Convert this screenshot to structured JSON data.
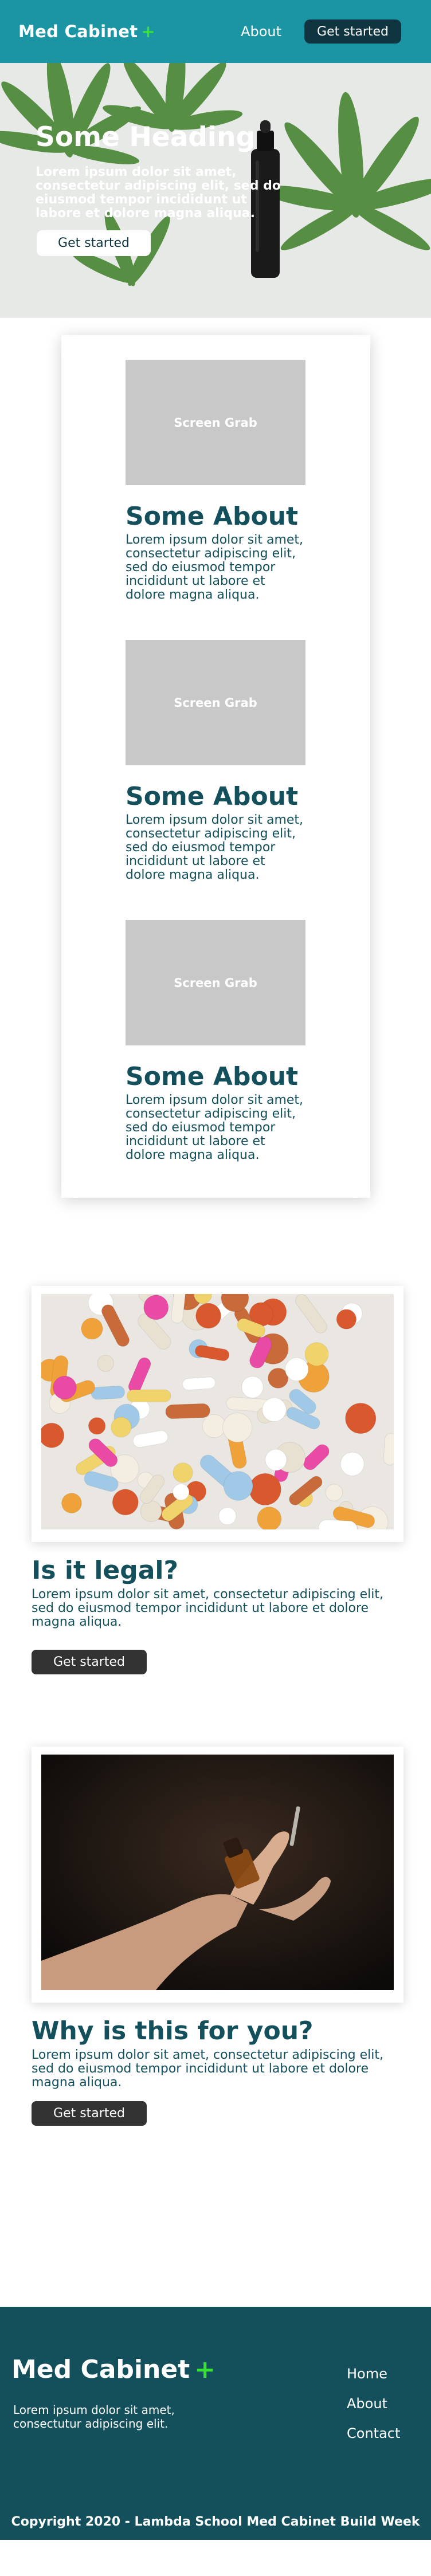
{
  "header": {
    "brand": "Med Cabinet",
    "brand_plus": "+",
    "nav_about": "About",
    "cta": "Get started"
  },
  "hero": {
    "heading": "Some Heading",
    "body": "Lorem ipsum dolor sit amet, consectetur adipiscing elit, sed do eiusmod tempor incididunt ut labore et dolore magna aliqua.",
    "cta": "Get started"
  },
  "about": {
    "items": [
      {
        "image_label": "Screen Grab",
        "title": "Some About",
        "body": "Lorem ipsum dolor sit amet, consectetur adipiscing elit, sed do eiusmod tempor incididunt ut labore et dolore magna aliqua."
      },
      {
        "image_label": "Screen Grab",
        "title": "Some About",
        "body": "Lorem ipsum dolor sit amet, consectetur adipiscing elit, sed do eiusmod tempor incididunt ut labore et dolore magna aliqua."
      },
      {
        "image_label": "Screen Grab",
        "title": "Some About",
        "body": "Lorem ipsum dolor sit amet, consectetur adipiscing elit, sed do eiusmod tempor incididunt ut labore et dolore magna aliqua."
      }
    ]
  },
  "legal": {
    "title": "Is it legal?",
    "body": "Lorem ipsum dolor sit amet, consectetur adipiscing elit, sed do eiusmod tempor incididunt ut labore et dolore magna aliqua.",
    "cta": "Get started"
  },
  "why": {
    "title": "Why is this for you?",
    "body": "Lorem ipsum dolor sit amet, consectetur adipiscing elit, sed do eiusmod tempor incididunt ut labore et dolore magna aliqua.",
    "cta": "Get started"
  },
  "footer": {
    "brand": "Med Cabinet",
    "brand_plus": "+",
    "tagline": "Lorem ipsum dolor sit amet, consectutur adipiscing elit.",
    "links": [
      "Home",
      "About",
      "Contact"
    ],
    "copyright": "Copyright 2020 - Lambda School Med Cabinet Build Week"
  },
  "colors": {
    "header_bg": "#1b95a4",
    "accent_green": "#39e036",
    "heading_text": "#13505c",
    "footer_bg": "#13505c",
    "button_dark": "#333333"
  }
}
